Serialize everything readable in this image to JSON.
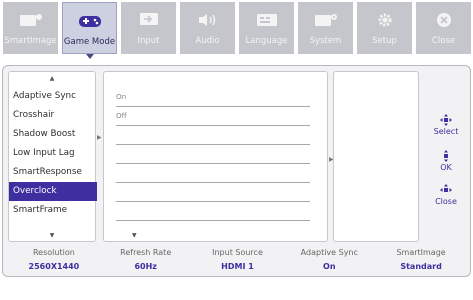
{
  "tabs": [
    {
      "label": "SmartImage",
      "icon": "smartimage-icon",
      "active": false
    },
    {
      "label": "Game Mode",
      "icon": "gamepad-icon",
      "active": true
    },
    {
      "label": "Input",
      "icon": "input-icon",
      "active": false
    },
    {
      "label": "Audio",
      "icon": "speaker-icon",
      "active": false
    },
    {
      "label": "Language",
      "icon": "language-icon",
      "active": false
    },
    {
      "label": "System",
      "icon": "system-icon",
      "active": false
    },
    {
      "label": "Setup",
      "icon": "gear-icon",
      "active": false
    },
    {
      "label": "Close",
      "icon": "close-icon",
      "active": false
    }
  ],
  "menu": {
    "items": [
      "Adaptive Sync",
      "Crosshair",
      "Shadow Boost",
      "Low Input Lag",
      "SmartResponse",
      "Overclock",
      "SmartFrame"
    ],
    "selected": "Overclock"
  },
  "submenu": {
    "values": [
      "On",
      "Off",
      "",
      "",
      "",
      "",
      ""
    ]
  },
  "controls": {
    "select": "Select",
    "ok": "OK",
    "close": "Close"
  },
  "status": [
    {
      "label": "Resolution",
      "value": "2560X1440"
    },
    {
      "label": "Refresh Rate",
      "value": "60Hz"
    },
    {
      "label": "Input Source",
      "value": "HDMI 1"
    },
    {
      "label": "Adaptive Sync",
      "value": "On"
    },
    {
      "label": "SmartImage",
      "value": "Standard"
    }
  ],
  "colors": {
    "accent": "#3d2fa0",
    "tab_bg": "#c4c6cb"
  }
}
